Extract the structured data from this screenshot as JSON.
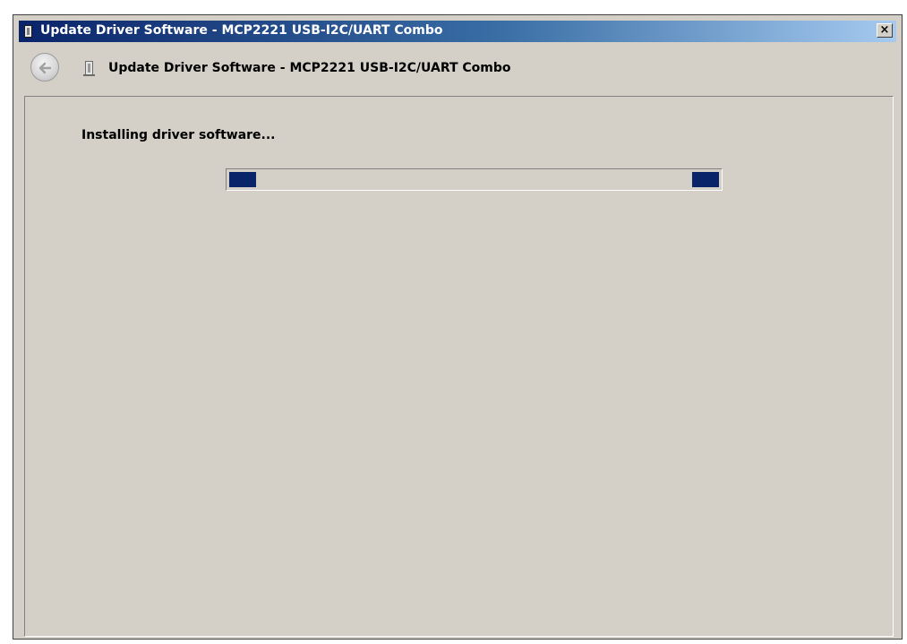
{
  "window": {
    "title": "Update Driver Software - MCP2221 USB-I2C/UART Combo",
    "close_label": "×"
  },
  "header": {
    "title": "Update Driver Software - MCP2221 USB-I2C/UART Combo",
    "back_icon": "back-arrow-icon",
    "device_icon": "usb-device-icon"
  },
  "content": {
    "status": "Installing driver software...",
    "progress": {
      "style": "marquee",
      "accent_color": "#0a246a"
    }
  },
  "colors": {
    "titlebar_start": "#0a246a",
    "titlebar_end": "#a6caf0",
    "window_bg": "#d4d0c8"
  }
}
